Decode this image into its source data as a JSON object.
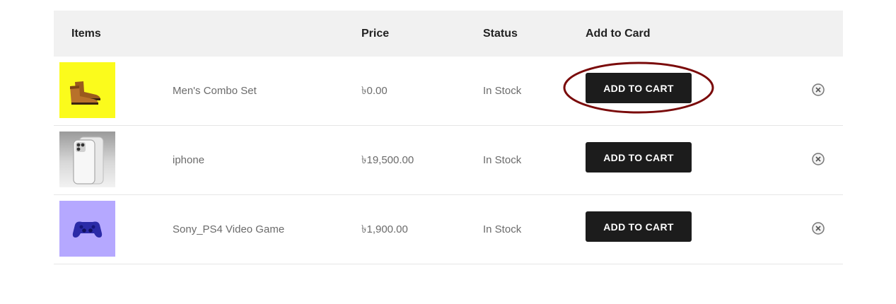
{
  "table": {
    "headers": {
      "items": "Items",
      "price": "Price",
      "status": "Status",
      "add": "Add to Card"
    },
    "rows": [
      {
        "image_icon": "boots-image",
        "image_bg": "#fbfb1c",
        "name": "Men's Combo Set",
        "price": "৳0.00",
        "status": "In Stock",
        "button": "ADD TO CART",
        "remove_icon": "close-circle-icon"
      },
      {
        "image_icon": "smartphone-image",
        "image_bg": "#c9c9c9",
        "name": "iphone",
        "price": "৳19,500.00",
        "status": "In Stock",
        "button": "ADD TO CART",
        "remove_icon": "close-circle-icon"
      },
      {
        "image_icon": "gamepad-image",
        "image_bg": "#b5a8ff",
        "name": "Sony_PS4 Video Game",
        "price": "৳1,900.00",
        "status": "In Stock",
        "button": "ADD TO CART",
        "remove_icon": "close-circle-icon"
      }
    ]
  },
  "annotation": {
    "type": "ellipse-highlight",
    "color": "#7a0a0a",
    "target": "first ADD TO CART button"
  },
  "colors": {
    "header_bg": "#f1f1f1",
    "button_bg": "#1c1c1c",
    "button_text": "#ffffff",
    "cell_text": "#6b6b6b"
  }
}
